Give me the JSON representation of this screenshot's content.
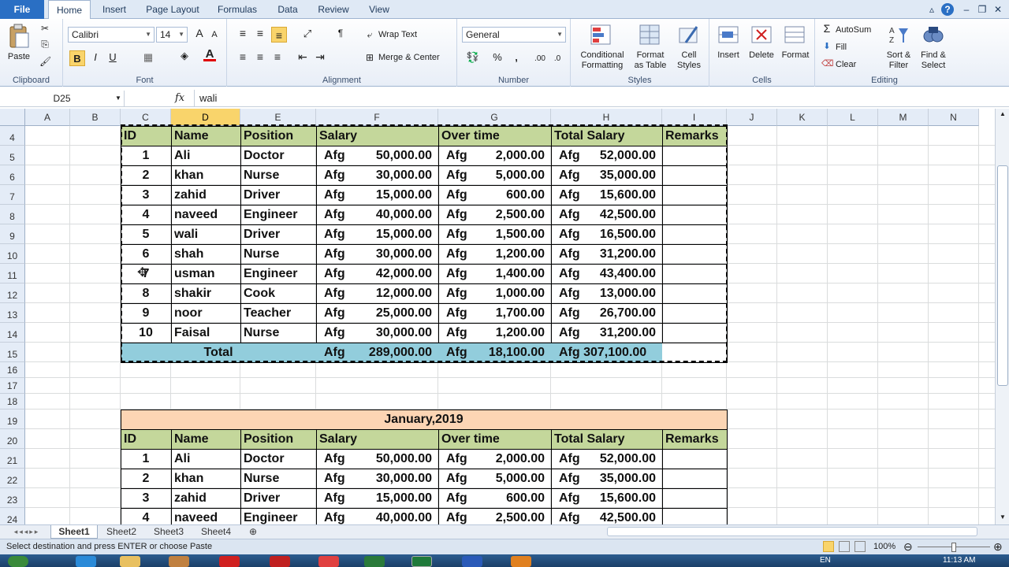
{
  "tabs": [
    "File",
    "Home",
    "Insert",
    "Page Layout",
    "Formulas",
    "Data",
    "Review",
    "View"
  ],
  "ribbon": {
    "clipboard": {
      "paste": "Paste",
      "label": "Clipboard"
    },
    "font": {
      "name": "Calibri",
      "size": "14",
      "label": "Font"
    },
    "alignment": {
      "wrap": "Wrap Text",
      "merge": "Merge & Center",
      "label": "Alignment"
    },
    "number": {
      "format": "General",
      "label": "Number"
    },
    "styles": {
      "cond1": "Conditional",
      "cond2": "Formatting",
      "fmt1": "Format",
      "fmt2": "as Table",
      "cell1": "Cell",
      "cell2": "Styles",
      "label": "Styles"
    },
    "cells": {
      "insert": "Insert",
      "delete": "Delete",
      "format": "Format",
      "label": "Cells"
    },
    "editing": {
      "autosum": "AutoSum",
      "fill": "Fill",
      "clear": "Clear",
      "sort1": "Sort &",
      "sort2": "Filter",
      "find1": "Find &",
      "find2": "Select",
      "label": "Editing"
    }
  },
  "formula_bar": {
    "name_box": "D25",
    "fx": "fx",
    "value": "wali"
  },
  "columns": [
    "A",
    "B",
    "C",
    "D",
    "E",
    "F",
    "G",
    "H",
    "I",
    "J",
    "K",
    "L",
    "M",
    "N"
  ],
  "rows": [
    "4",
    "5",
    "6",
    "7",
    "8",
    "9",
    "10",
    "11",
    "12",
    "13",
    "14",
    "15",
    "16",
    "17",
    "18",
    "19",
    "20",
    "21",
    "22",
    "23",
    "24"
  ],
  "table1": {
    "headers": [
      "ID",
      "Name",
      "Position",
      "Salary",
      "Over time",
      "Total Salary",
      "Remarks"
    ],
    "currency": "Afg",
    "rows": [
      [
        "1",
        "Ali",
        "Doctor",
        "50,000.00",
        "2,000.00",
        "52,000.00"
      ],
      [
        "2",
        "khan",
        "Nurse",
        "30,000.00",
        "5,000.00",
        "35,000.00"
      ],
      [
        "3",
        "zahid",
        "Driver",
        "15,000.00",
        "600.00",
        "15,600.00"
      ],
      [
        "4",
        "naveed",
        "Engineer",
        "40,000.00",
        "2,500.00",
        "42,500.00"
      ],
      [
        "5",
        "wali",
        "Driver",
        "15,000.00",
        "1,500.00",
        "16,500.00"
      ],
      [
        "6",
        "shah",
        "Nurse",
        "30,000.00",
        "1,200.00",
        "31,200.00"
      ],
      [
        "7",
        "usman",
        "Engineer",
        "42,000.00",
        "1,400.00",
        "43,400.00"
      ],
      [
        "8",
        "shakir",
        "Cook",
        "12,000.00",
        "1,000.00",
        "13,000.00"
      ],
      [
        "9",
        "noor",
        "Teacher",
        "25,000.00",
        "1,700.00",
        "26,700.00"
      ],
      [
        "10",
        "Faisal",
        "Nurse",
        "30,000.00",
        "1,200.00",
        "31,200.00"
      ]
    ],
    "total": {
      "label": "Total",
      "salary": "289,000.00",
      "overtime": "18,100.00",
      "total": "Afg 307,100.00"
    }
  },
  "table2": {
    "title": "January,2019",
    "headers": [
      "ID",
      "Name",
      "Position",
      "Salary",
      "Over time",
      "Total Salary",
      "Remarks"
    ],
    "rows": [
      [
        "1",
        "Ali",
        "Doctor",
        "50,000.00",
        "2,000.00",
        "52,000.00"
      ],
      [
        "2",
        "khan",
        "Nurse",
        "30,000.00",
        "5,000.00",
        "35,000.00"
      ],
      [
        "3",
        "zahid",
        "Driver",
        "15,000.00",
        "600.00",
        "15,600.00"
      ],
      [
        "4",
        "naveed",
        "Engineer",
        "40,000.00",
        "2,500.00",
        "42,500.00"
      ]
    ]
  },
  "sheets": [
    "Sheet1",
    "Sheet2",
    "Sheet3",
    "Sheet4"
  ],
  "status": {
    "message": "Select destination and press ENTER or choose Paste",
    "zoom": "100%"
  },
  "clock": {
    "time": "11:13 AM",
    "lang": "EN"
  },
  "colors": {
    "header_green": "#c4d79b",
    "total_blue": "#92cddc",
    "title_peach": "#fcd5b4",
    "selected_col": "#f9d46b"
  }
}
